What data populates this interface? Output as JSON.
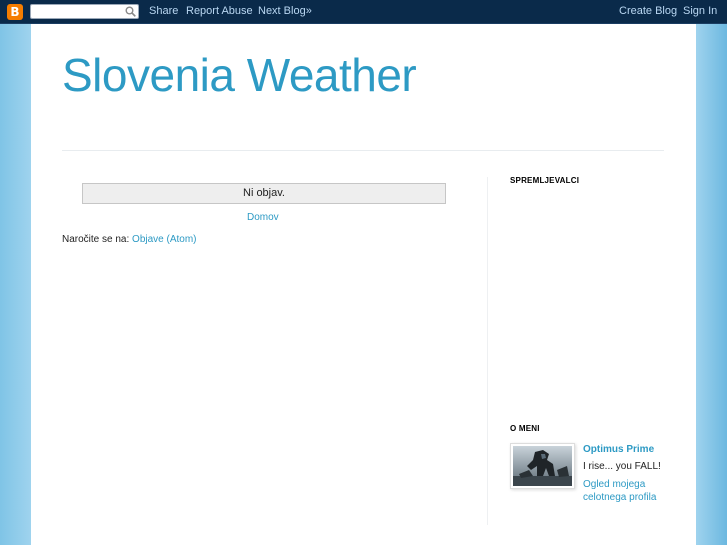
{
  "navbar": {
    "logo_letter": "B",
    "search": {
      "value": "",
      "placeholder": ""
    },
    "share": "Share",
    "report_abuse": "Report Abuse",
    "next_blog": "Next Blog»",
    "create_blog": "Create Blog",
    "sign_in": "Sign In",
    "colors": {
      "background": "#0a2a4a",
      "link": "#b9d7f2",
      "logo": "#f57d00"
    }
  },
  "blog": {
    "title": "Slovenia Weather",
    "title_color": "#2d9ac4"
  },
  "main": {
    "status_message": "Ni objav.",
    "home_link": "Domov",
    "subscribe_label": "Naročite se na: ",
    "subscribe_link": "Objave (Atom)"
  },
  "sidebar": {
    "followers_title": "SPREMLJEVALCI",
    "about_title": "O MENI",
    "profile": {
      "name": "Optimus Prime",
      "about": "I rise... you FALL!",
      "view_profile": "Ogled mojega celotnega profila"
    }
  }
}
